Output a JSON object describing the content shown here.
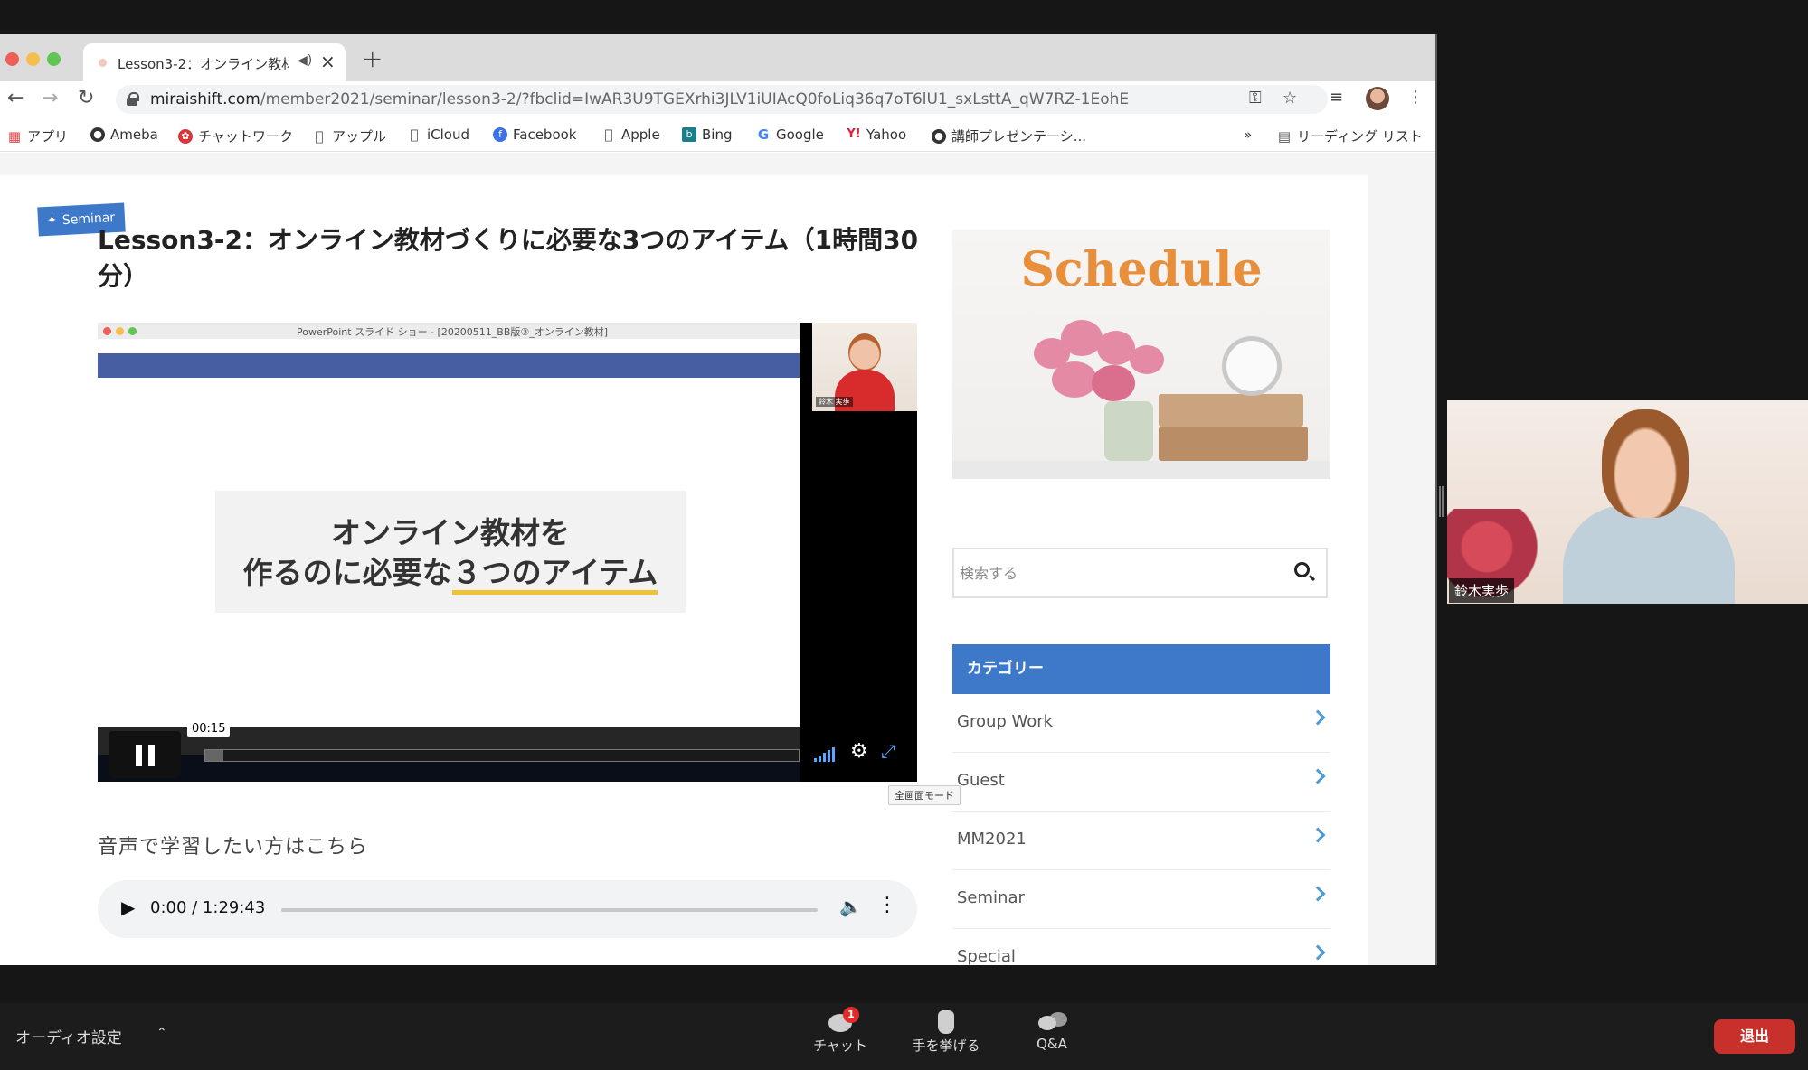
{
  "browser": {
    "tab_title": "Lesson3-2：オンライン教材",
    "new_tab": "+",
    "url_domain": "miraishift.com",
    "url_path": "/member2021/seminar/lesson3-2/?fbclid=IwAR3U9TGEXrhi3JLV1iUIAcQ0foLiq36q7oT6lU1_sxLsttA_qW7RZ-1EohE",
    "bookmarks": [
      "アプリ",
      "Ameba",
      "チャットワーク",
      "アップル",
      "iCloud",
      "Facebook",
      "Apple",
      "Bing",
      "Google",
      "Yahoo",
      "講師プレゼンテーシ..."
    ],
    "bookmarks_more": "»",
    "reading_list": "リーディング リスト"
  },
  "page": {
    "category_badge": "Seminar",
    "title": "Lesson3-2：オンライン教材づくりに必要な3つのアイテム（1時間30分）",
    "video": {
      "window_title": "PowerPoint スライド ショー - [20200511_BB版③_オンライン教材]",
      "slide_line1": "オンライン教材を",
      "slide_line2_prefix": "作るのに必要な",
      "slide_line2_highlight": "３つのアイテム",
      "presenter_label": "鈴木 実歩",
      "current_time": "00:15",
      "progress": 0.03,
      "fullscreen_tooltip": "全画面モード"
    },
    "audio_prompt": "音声で学習したい方はこちら",
    "audio_player": {
      "time": "0:00 / 1:29:43",
      "progress": 0
    }
  },
  "sidebar": {
    "schedule_banner": "Schedule",
    "search_placeholder": "検索する",
    "category_heading": "カテゴリー",
    "categories": [
      "Group Work",
      "Guest",
      "MM2021",
      "Seminar",
      "Special"
    ]
  },
  "meeting": {
    "speaker_name": "鈴木実歩",
    "audio_settings": "オーディオ設定",
    "chat_label": "チャット",
    "chat_badge": "1",
    "raise_hand_label": "手を挙げる",
    "qa_label": "Q&A",
    "leave_label": "退出"
  },
  "colors": {
    "accent_blue": "#3e78c9",
    "schedule_orange": "#e88f3c",
    "leave_red": "#c8312b"
  }
}
